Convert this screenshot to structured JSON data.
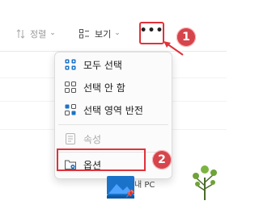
{
  "toolbar": {
    "sort_label": "정렬",
    "view_label": "보기",
    "more_label": "•••"
  },
  "badges": {
    "first": "1",
    "second": "2"
  },
  "menu": {
    "items": [
      {
        "label": "모두 선택",
        "icon": "select-all-icon",
        "disabled": false
      },
      {
        "label": "선택 안 함",
        "icon": "select-none-icon",
        "disabled": false
      },
      {
        "label": "선택 영역 반전",
        "icon": "invert-selection-icon",
        "disabled": false
      },
      {
        "label": "속성",
        "icon": "properties-icon",
        "disabled": true
      },
      {
        "label": "옵션",
        "icon": "options-icon",
        "disabled": false
      }
    ]
  },
  "desktop": {
    "this_pc_label": "내 PC"
  },
  "colors": {
    "highlight": "#e0323a",
    "badge": "#d5454b",
    "accent": "#1a73c9"
  }
}
